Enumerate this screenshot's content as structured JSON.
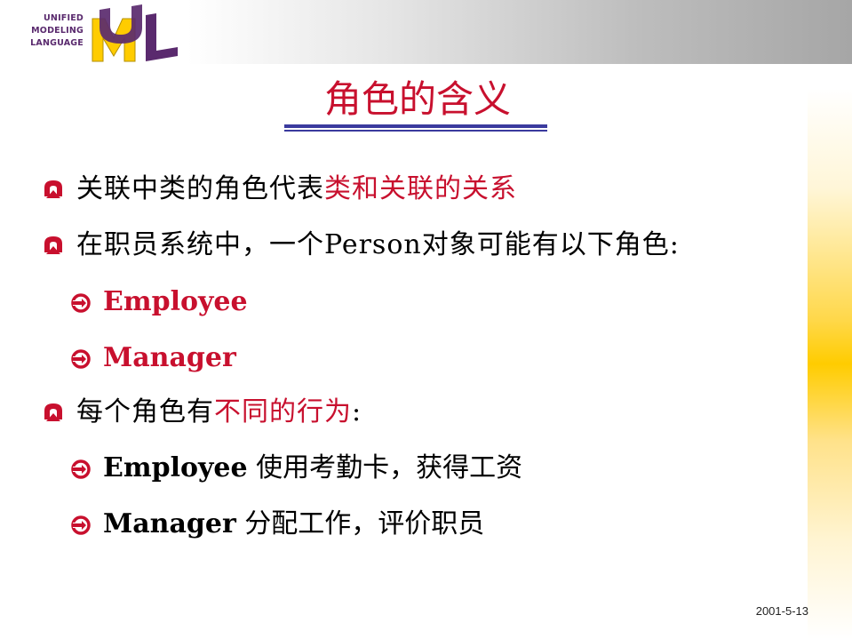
{
  "logo": {
    "lines": [
      "UNIFIED",
      "MODELING",
      "LANGUAGE"
    ]
  },
  "title": "角色的含义",
  "bullets": [
    {
      "text": "关联中类的角色代表",
      "highlight": "类和关联的关系"
    },
    {
      "text": "在职员系统中，一个Person对象可能有以下角色:"
    },
    {
      "sub": "Employee"
    },
    {
      "sub": "Manager"
    },
    {
      "text": "每个角色有",
      "highlight": "不同的行为",
      "tail": ":"
    },
    {
      "sub": "Employee",
      "tail": " 使用考勤卡，获得工资"
    },
    {
      "sub": "Manager",
      "tail": " 分配工作，评价职员"
    }
  ],
  "footer": {
    "date": "2001-5-13"
  },
  "colors": {
    "accent_red": "#c8102e",
    "rule_blue": "#3a3a9e",
    "logo_purple": "#5a2a6e",
    "logo_yellow": "#ffcc00"
  },
  "icons": {
    "bullet": "wingdings-bullet-icon",
    "sub_bullet": "arrow-bullet-icon"
  }
}
